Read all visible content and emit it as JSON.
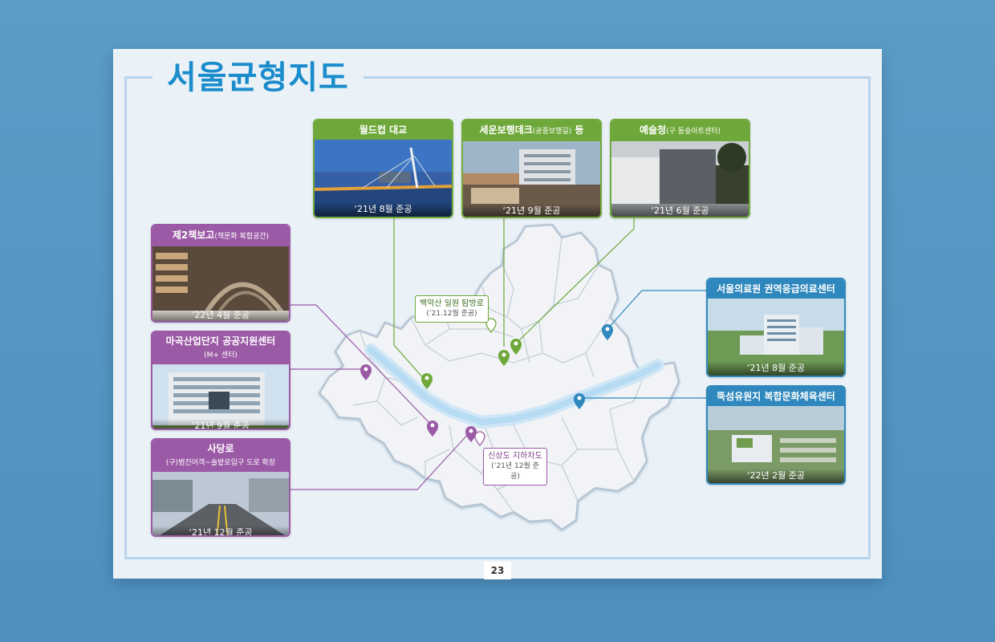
{
  "title": "서울균형지도",
  "page_number": "23",
  "colors": {
    "green": "#6fa83a",
    "purple": "#9b5aa6",
    "blue": "#2f88bd",
    "title": "#1b8ccc"
  },
  "cards": {
    "worldcup": {
      "title": "월드컵 대교",
      "caption": "‘21년 8월 준공"
    },
    "sewoon": {
      "title": "세운보행데크",
      "subtitle": "(공중보행길)",
      "suffix": " 등",
      "caption": "‘21년 9월 준공"
    },
    "yesulcheong": {
      "title": "예술청",
      "subtitle": "(구 동숭아트센터)",
      "caption": "‘21년 6월 준공"
    },
    "bookgo": {
      "title": "제2책보고",
      "subtitle": "(책문화 복합공간)",
      "caption": "‘22년 4월 준공"
    },
    "magok": {
      "title": "마곡산업단지 공공지원센터",
      "subtitle": "(M+ 센터)",
      "caption": "‘21년 9월 준공"
    },
    "sadang": {
      "title": "사당로",
      "subtitle": "(구)범진어객~솔밭로입구  도로 확장",
      "caption": "‘21년 12월 준공"
    },
    "medical": {
      "title": "서울의료원 권역응급의료센터",
      "caption": "‘21년 8월 준공"
    },
    "ttukseom": {
      "title": "뚝섬유원지 복합문화체육센터",
      "caption": "‘22년 2월 준공"
    }
  },
  "labels": {
    "baegak": {
      "title": "백악산 일원 탐방로",
      "sub": "(’21.12월 준공)"
    },
    "sinsangdo": {
      "title": "신상도 지하차도",
      "sub": "(’21년 12월 준공)"
    }
  }
}
